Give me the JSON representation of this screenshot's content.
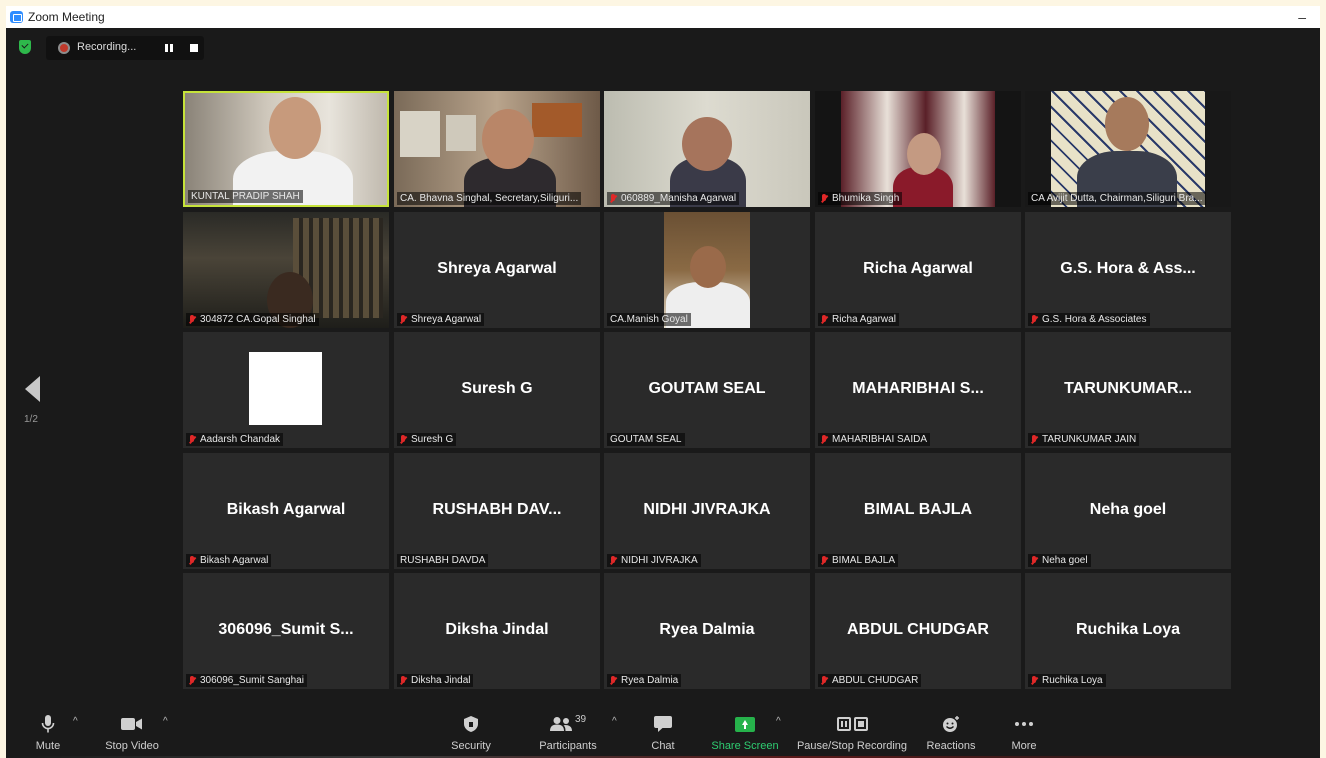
{
  "window": {
    "title": "Zoom Meeting",
    "minimize": "–"
  },
  "recording": {
    "status": "Recording..."
  },
  "pager": {
    "page": "1/2"
  },
  "tiles": [
    {
      "name": "KUNTAL PRADIP SHAH",
      "label": "KUNTAL PRADIP SHAH",
      "muted": false,
      "video": true
    },
    {
      "name": "CA. Bhavna Singhal, Secretary,Siliguri...",
      "label": "CA. Bhavna Singhal, Secretary,Siliguri...",
      "muted": false,
      "video": true
    },
    {
      "name": "060889_Manisha Agarwal",
      "label": "060889_Manisha Agarwal",
      "muted": true,
      "video": true
    },
    {
      "name": "Bhumika Singh",
      "label": "Bhumika Singh",
      "muted": true,
      "video": true
    },
    {
      "name": "CA Avijit Dutta, Chairman,Siliguri Bra...",
      "label": "CA Avijit Dutta, Chairman,Siliguri Bra...",
      "muted": false,
      "video": true
    },
    {
      "name": "304872 CA.Gopal Singhal",
      "label": "304872 CA.Gopal Singhal",
      "muted": true,
      "video": true
    },
    {
      "name": "Shreya Agarwal",
      "label": "Shreya Agarwal",
      "muted": true,
      "video": false
    },
    {
      "name": "CA.Manish Goyal",
      "label": "CA.Manish Goyal",
      "muted": false,
      "video": true
    },
    {
      "name": "Richa Agarwal",
      "label": "Richa Agarwal",
      "muted": true,
      "video": false
    },
    {
      "name": "G.S. Hora & Ass...",
      "label": "G.S. Hora & Associates",
      "muted": true,
      "video": false
    },
    {
      "name": "",
      "label": "Aadarsh Chandak",
      "muted": true,
      "video": false
    },
    {
      "name": "Suresh G",
      "label": "Suresh G",
      "muted": true,
      "video": false
    },
    {
      "name": "GOUTAM SEAL",
      "label": "GOUTAM SEAL",
      "muted": false,
      "video": false
    },
    {
      "name": "MAHARIBHAI  S...",
      "label": "MAHARIBHAI SAIDA",
      "muted": true,
      "video": false
    },
    {
      "name": "TARUNKUMAR...",
      "label": "TARUNKUMAR JAIN",
      "muted": true,
      "video": false
    },
    {
      "name": "Bikash Agarwal",
      "label": "Bikash Agarwal",
      "muted": true,
      "video": false
    },
    {
      "name": "RUSHABH  DAV...",
      "label": "RUSHABH DAVDA",
      "muted": false,
      "video": false
    },
    {
      "name": "NIDHI JIVRAJKA",
      "label": "NIDHI JIVRAJKA",
      "muted": true,
      "video": false
    },
    {
      "name": "BIMAL BAJLA",
      "label": "BIMAL BAJLA",
      "muted": true,
      "video": false
    },
    {
      "name": "Neha goel",
      "label": "Neha goel",
      "muted": true,
      "video": false
    },
    {
      "name": "306096_Sumit  S...",
      "label": "306096_Sumit Sanghai",
      "muted": true,
      "video": false
    },
    {
      "name": "Diksha Jindal",
      "label": "Diksha Jindal",
      "muted": true,
      "video": false
    },
    {
      "name": "Ryea Dalmia",
      "label": "Ryea Dalmia",
      "muted": true,
      "video": false
    },
    {
      "name": "ABDUL CHUDGAR",
      "label": "ABDUL CHUDGAR",
      "muted": true,
      "video": false
    },
    {
      "name": "Ruchika Loya",
      "label": "Ruchika Loya",
      "muted": true,
      "video": false
    }
  ],
  "toolbar": {
    "mute": "Mute",
    "stop_video": "Stop Video",
    "security": "Security",
    "participants": "Participants",
    "participants_count": "39",
    "chat": "Chat",
    "share_screen": "Share Screen",
    "pause_stop_recording": "Pause/Stop Recording",
    "reactions": "Reactions",
    "more": "More"
  },
  "colors": {
    "active_speaker": "#c6e33a",
    "share_green": "#26b24b",
    "muted_red": "#e02828"
  }
}
